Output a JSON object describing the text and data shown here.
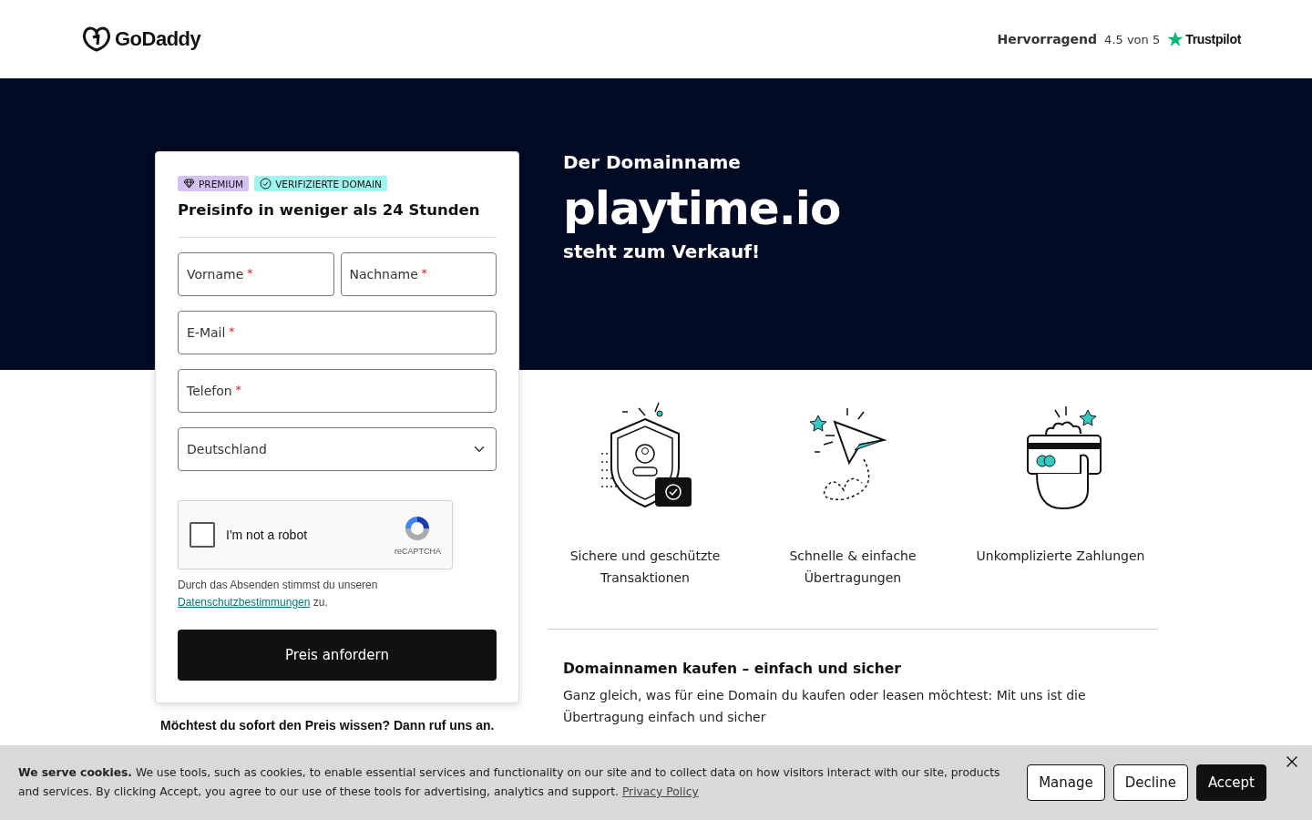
{
  "header": {
    "logo": "GoDaddy",
    "rating": {
      "label": "Hervorragend",
      "score": "4.5 von 5",
      "brand": "Trustpilot"
    }
  },
  "form": {
    "badges": [
      {
        "kind": "premium",
        "label": "PREMIUM"
      },
      {
        "kind": "verified",
        "label": "VERIFIZIERTE DOMAIN"
      }
    ],
    "title": "Preisinfo in weniger als 24 Stunden",
    "name_fields": [
      {
        "placeholder": "Vorname",
        "mark": "*"
      },
      {
        "placeholder": "Nachname",
        "mark": "*"
      }
    ],
    "fields": [
      {
        "kind": "text",
        "placeholder": "E-Mail",
        "mark": "*"
      },
      {
        "kind": "text",
        "placeholder": "Telefon",
        "mark": "*"
      },
      {
        "kind": "select",
        "value": "Deutschland"
      }
    ],
    "captcha": {
      "label": "I'm not a robot",
      "brand": "reCAPTCHA",
      "checked": false
    },
    "consent": {
      "text": "Durch das Absenden stimmst du unseren",
      "link": "Datenschutzbestimmungen",
      "end": "zu."
    },
    "submit": "Preis anfordern"
  },
  "call_prompt": "Möchtest du sofort den Preis wissen? Dann ruf uns an.",
  "hero": {
    "intro": "Der Domainname",
    "domain": "playtime.io",
    "tagline": "steht zum Verkauf!"
  },
  "features": [
    {
      "kind": "shield",
      "label": "Sichere und geschützte Transaktionen"
    },
    {
      "kind": "plane",
      "label": "Schnelle & einfache Übertragungen"
    },
    {
      "kind": "card",
      "label": "Unkomplizierte Zahlungen"
    }
  ],
  "section": {
    "title": "Domainnamen kaufen – einfach und sicher",
    "text": "Ganz gleich, was für eine Domain du kaufen oder leasen möchtest: Mit uns ist die Übertragung einfach und sicher"
  },
  "cookie_banner": {
    "text": "**We serve cookies.** We use tools, such as cookies, to enable essential services and functionality on our site and to collect data on how visitors interact with our site, products and services. By clicking Accept, you agree to our use of these tools for advertising, analytics and support.",
    "link": "Privacy Policy",
    "buttons": [
      {
        "kind": "outline",
        "label": "Manage"
      },
      {
        "kind": "outline",
        "label": "Decline"
      },
      {
        "kind": "primary",
        "label": "Accept"
      }
    ]
  }
}
